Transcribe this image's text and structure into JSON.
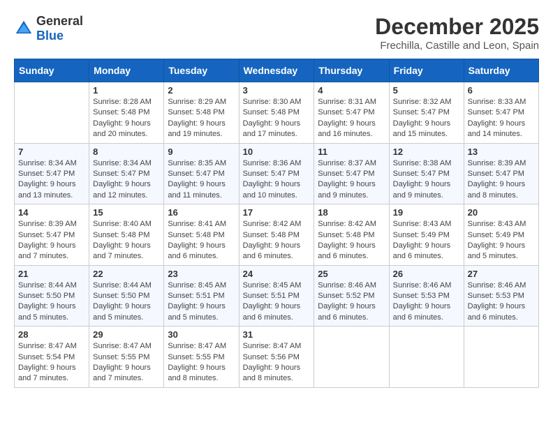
{
  "header": {
    "logo": {
      "general": "General",
      "blue": "Blue"
    },
    "title": "December 2025",
    "location": "Frechilla, Castille and Leon, Spain"
  },
  "calendar": {
    "columns": [
      "Sunday",
      "Monday",
      "Tuesday",
      "Wednesday",
      "Thursday",
      "Friday",
      "Saturday"
    ],
    "rows": [
      [
        {
          "day": "",
          "info": ""
        },
        {
          "day": "1",
          "info": "Sunrise: 8:28 AM\nSunset: 5:48 PM\nDaylight: 9 hours\nand 20 minutes."
        },
        {
          "day": "2",
          "info": "Sunrise: 8:29 AM\nSunset: 5:48 PM\nDaylight: 9 hours\nand 19 minutes."
        },
        {
          "day": "3",
          "info": "Sunrise: 8:30 AM\nSunset: 5:48 PM\nDaylight: 9 hours\nand 17 minutes."
        },
        {
          "day": "4",
          "info": "Sunrise: 8:31 AM\nSunset: 5:47 PM\nDaylight: 9 hours\nand 16 minutes."
        },
        {
          "day": "5",
          "info": "Sunrise: 8:32 AM\nSunset: 5:47 PM\nDaylight: 9 hours\nand 15 minutes."
        },
        {
          "day": "6",
          "info": "Sunrise: 8:33 AM\nSunset: 5:47 PM\nDaylight: 9 hours\nand 14 minutes."
        }
      ],
      [
        {
          "day": "7",
          "info": "Sunrise: 8:34 AM\nSunset: 5:47 PM\nDaylight: 9 hours\nand 13 minutes."
        },
        {
          "day": "8",
          "info": "Sunrise: 8:34 AM\nSunset: 5:47 PM\nDaylight: 9 hours\nand 12 minutes."
        },
        {
          "day": "9",
          "info": "Sunrise: 8:35 AM\nSunset: 5:47 PM\nDaylight: 9 hours\nand 11 minutes."
        },
        {
          "day": "10",
          "info": "Sunrise: 8:36 AM\nSunset: 5:47 PM\nDaylight: 9 hours\nand 10 minutes."
        },
        {
          "day": "11",
          "info": "Sunrise: 8:37 AM\nSunset: 5:47 PM\nDaylight: 9 hours\nand 9 minutes."
        },
        {
          "day": "12",
          "info": "Sunrise: 8:38 AM\nSunset: 5:47 PM\nDaylight: 9 hours\nand 9 minutes."
        },
        {
          "day": "13",
          "info": "Sunrise: 8:39 AM\nSunset: 5:47 PM\nDaylight: 9 hours\nand 8 minutes."
        }
      ],
      [
        {
          "day": "14",
          "info": "Sunrise: 8:39 AM\nSunset: 5:47 PM\nDaylight: 9 hours\nand 7 minutes."
        },
        {
          "day": "15",
          "info": "Sunrise: 8:40 AM\nSunset: 5:48 PM\nDaylight: 9 hours\nand 7 minutes."
        },
        {
          "day": "16",
          "info": "Sunrise: 8:41 AM\nSunset: 5:48 PM\nDaylight: 9 hours\nand 6 minutes."
        },
        {
          "day": "17",
          "info": "Sunrise: 8:42 AM\nSunset: 5:48 PM\nDaylight: 9 hours\nand 6 minutes."
        },
        {
          "day": "18",
          "info": "Sunrise: 8:42 AM\nSunset: 5:48 PM\nDaylight: 9 hours\nand 6 minutes."
        },
        {
          "day": "19",
          "info": "Sunrise: 8:43 AM\nSunset: 5:49 PM\nDaylight: 9 hours\nand 6 minutes."
        },
        {
          "day": "20",
          "info": "Sunrise: 8:43 AM\nSunset: 5:49 PM\nDaylight: 9 hours\nand 5 minutes."
        }
      ],
      [
        {
          "day": "21",
          "info": "Sunrise: 8:44 AM\nSunset: 5:50 PM\nDaylight: 9 hours\nand 5 minutes."
        },
        {
          "day": "22",
          "info": "Sunrise: 8:44 AM\nSunset: 5:50 PM\nDaylight: 9 hours\nand 5 minutes."
        },
        {
          "day": "23",
          "info": "Sunrise: 8:45 AM\nSunset: 5:51 PM\nDaylight: 9 hours\nand 5 minutes."
        },
        {
          "day": "24",
          "info": "Sunrise: 8:45 AM\nSunset: 5:51 PM\nDaylight: 9 hours\nand 6 minutes."
        },
        {
          "day": "25",
          "info": "Sunrise: 8:46 AM\nSunset: 5:52 PM\nDaylight: 9 hours\nand 6 minutes."
        },
        {
          "day": "26",
          "info": "Sunrise: 8:46 AM\nSunset: 5:53 PM\nDaylight: 9 hours\nand 6 minutes."
        },
        {
          "day": "27",
          "info": "Sunrise: 8:46 AM\nSunset: 5:53 PM\nDaylight: 9 hours\nand 6 minutes."
        }
      ],
      [
        {
          "day": "28",
          "info": "Sunrise: 8:47 AM\nSunset: 5:54 PM\nDaylight: 9 hours\nand 7 minutes."
        },
        {
          "day": "29",
          "info": "Sunrise: 8:47 AM\nSunset: 5:55 PM\nDaylight: 9 hours\nand 7 minutes."
        },
        {
          "day": "30",
          "info": "Sunrise: 8:47 AM\nSunset: 5:55 PM\nDaylight: 9 hours\nand 8 minutes."
        },
        {
          "day": "31",
          "info": "Sunrise: 8:47 AM\nSunset: 5:56 PM\nDaylight: 9 hours\nand 8 minutes."
        },
        {
          "day": "",
          "info": ""
        },
        {
          "day": "",
          "info": ""
        },
        {
          "day": "",
          "info": ""
        }
      ]
    ]
  }
}
